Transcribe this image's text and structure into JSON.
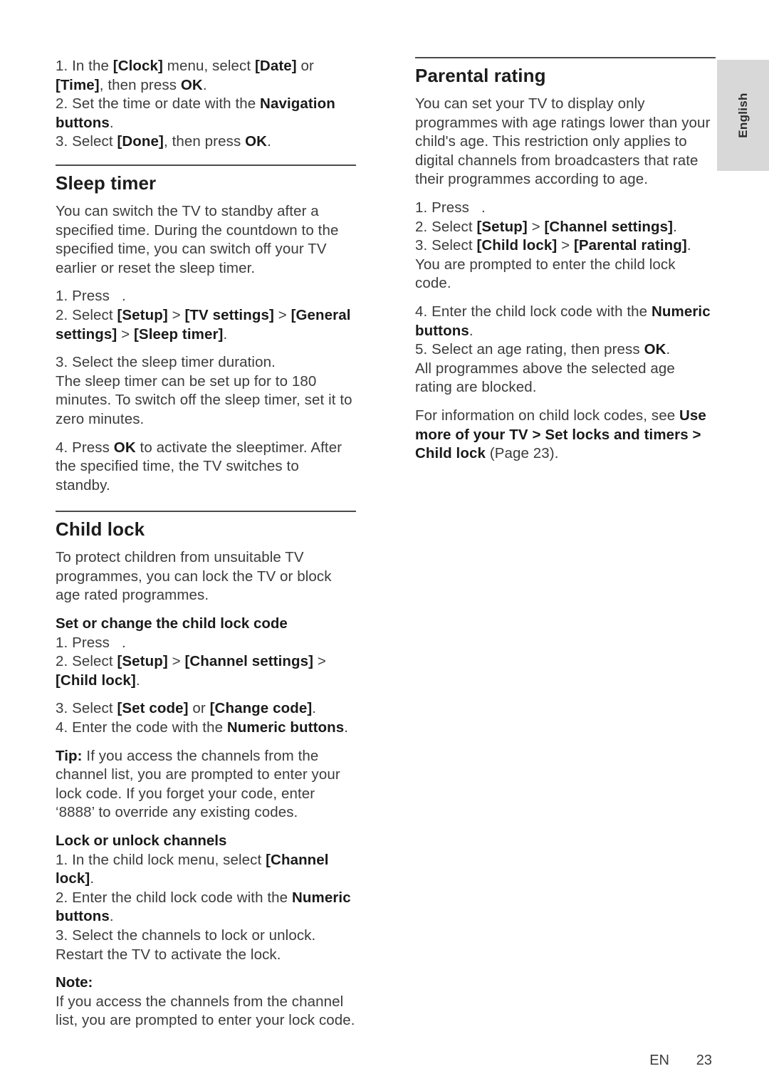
{
  "document": {
    "language_tab": "English",
    "footer": {
      "language_code": "EN",
      "page_number": "23"
    }
  },
  "left_column": {
    "clock_steps": {
      "step1_a": "1. In the ",
      "step1_clock": "[Clock]",
      "step1_b": " menu, select ",
      "step1_date": "[Date]",
      "step1_c": " or ",
      "step1_time": "[Time]",
      "step1_d": ", then press ",
      "step1_ok": "OK",
      "step1_e": ".",
      "step2_a": "2. Set the time or date with the ",
      "step2_nav": "Navigation buttons",
      "step2_b": ".",
      "step3_a": "3. Select ",
      "step3_done": "[Done]",
      "step3_b": ", then press ",
      "step3_ok": "OK",
      "step3_c": "."
    },
    "sleep_timer": {
      "heading": "Sleep timer",
      "intro": "You can switch the TV to standby after a specified time. During the countdown to the specified time, you can switch off your TV earlier or reset the sleep timer.",
      "step1": "1. Press",
      "step1_end": ".",
      "step2_a": "2. Select ",
      "step2_setup": "[Setup]",
      "step2_gt1": " > ",
      "step2_tv": "[TV settings]",
      "step2_gt2": " > ",
      "step2_general": "[General settings]",
      "step2_gt3": " > ",
      "step2_sleep": "[Sleep timer]",
      "step2_end": ".",
      "step3": "3. Select the sleep timer duration.",
      "step3_note": "The sleep timer can be set up for to 180 minutes. To switch off the sleep timer, set it to zero minutes.",
      "step4_a": "4. Press ",
      "step4_ok": "OK",
      "step4_b": " to activate the sleeptimer. After the specified time, the TV switches to standby."
    },
    "child_lock": {
      "heading": "Child lock",
      "intro": "To protect children from unsuitable TV programmes, you can lock the TV or block age rated programmes.",
      "subhead_set_code": "Set or change the child lock code",
      "step1": "1. Press",
      "step1_end": ".",
      "step2_a": "2. Select ",
      "step2_setup": "[Setup]",
      "step2_gt1": " > ",
      "step2_channel": "[Channel settings]",
      "step2_gt2": " > ",
      "step2_childlock": "[Child lock]",
      "step2_end": ".",
      "step3_a": "3. Select ",
      "step3_setcode": "[Set code]",
      "step3_b": " or ",
      "step3_changecode": "[Change code]",
      "step3_c": ".",
      "step4_a": "4. Enter the code with the ",
      "step4_numeric": "Numeric buttons",
      "step4_b": ".",
      "tip_label": "Tip:",
      "tip_text": " If you access the channels from the channel list, you are prompted to enter your lock code. If you forget your code, enter ‘8888’ to override any existing codes.",
      "subhead_lock_unlock": "Lock or unlock channels",
      "lu_step1_a": "1. In the child lock menu, select ",
      "lu_step1_channel": "[Channel lock]",
      "lu_step1_b": ".",
      "lu_step2_a": "2. Enter the child lock code with the ",
      "lu_step2_numeric": "Numeric buttons",
      "lu_step2_b": ".",
      "lu_step3": "3. Select the channels to lock or unlock. Restart the TV to activate the lock.",
      "note_label": "Note:",
      "note_text": "If you access the channels from the channel list, you are prompted to enter your lock code."
    }
  },
  "right_column": {
    "parental_rating": {
      "heading": "Parental rating",
      "intro": "You can set your TV to display only programmes with age ratings lower than your child's age. This restriction only applies to digital channels from broadcasters that rate their programmes according to age.",
      "step1": "1. Press",
      "step1_end": ".",
      "step2_a": "2. Select ",
      "step2_setup": "[Setup]",
      "step2_gt": " > ",
      "step2_channel": "[Channel settings]",
      "step2_end": ".",
      "step3_a": "3. Select ",
      "step3_childlock": "[Child lock]",
      "step3_gt": " > ",
      "step3_parental": "[Parental rating]",
      "step3_end": ".",
      "step3_note": "You are prompted to enter the child lock code.",
      "step4_a": "4. Enter the child lock code with the ",
      "step4_numeric": "Numeric buttons",
      "step4_b": ".",
      "step5_a": "5. Select an age rating, then press ",
      "step5_ok": "OK",
      "step5_b": ".",
      "step5_note": "All programmes above the selected age rating are blocked.",
      "xref_a": "For information on child lock codes, see ",
      "xref_bold": "Use more of your TV > Set locks and timers > Child lock",
      "xref_b": " (Page 23)."
    }
  }
}
